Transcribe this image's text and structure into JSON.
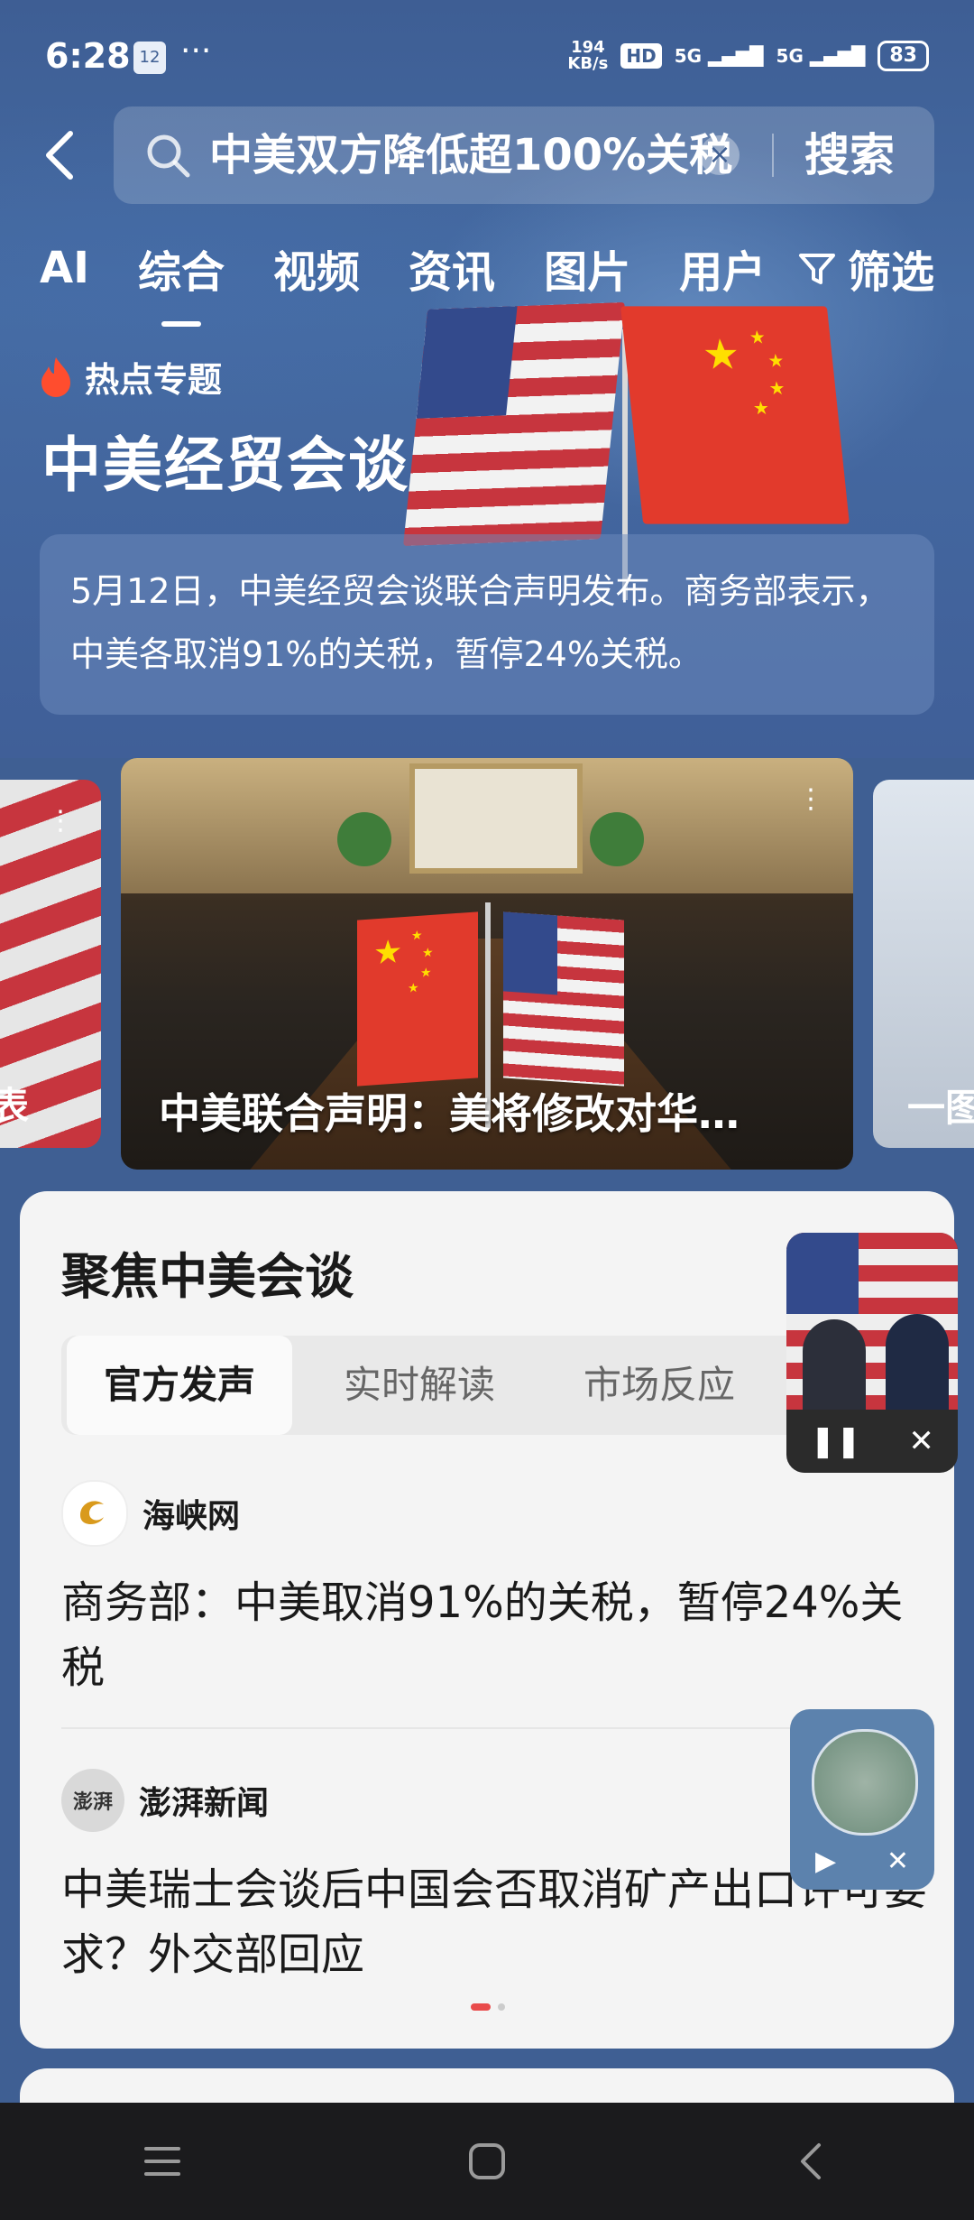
{
  "status_bar": {
    "time": "6:28",
    "notification_badge": "12",
    "more": "···",
    "net_speed_value": "194",
    "net_speed_unit": "KB/s",
    "hd_label": "HD",
    "signal_1": "5G",
    "signal_2": "5G",
    "battery": "83"
  },
  "search": {
    "query": "中美双方降低超100%关税",
    "button_label": "搜索"
  },
  "tabs": [
    "AI",
    "综合",
    "视频",
    "资讯",
    "图片",
    "用户"
  ],
  "active_tab": "综合",
  "filter_label": "筛选",
  "hero": {
    "tag": "热点专题",
    "title": "中美经贸会谈",
    "summary": "5月12日，中美经贸会谈联合声明发布。商务部表示，中美各取消91%的关税，暂停24%关税。"
  },
  "carousel": {
    "left_caption": "表",
    "main_caption": "中美联合声明：美将修改对华…",
    "right_caption": "一图"
  },
  "focus": {
    "title": "聚焦中美会谈",
    "segments": [
      "官方发声",
      "实时解读",
      "市场反应"
    ],
    "active_segment": "官方发声",
    "items": [
      {
        "source": "海峡网",
        "logo_text": "海峡网",
        "title": "商务部：中美取消91%的关税，暂停24%关税"
      },
      {
        "source": "澎湃新闻",
        "logo_text": "澎湃",
        "title": "中美瑞士会谈后中国会否取消矿产出口许可要求？外交部回应"
      }
    ]
  },
  "float_video": {
    "pause_icon": "pause-icon",
    "close_icon": "close-icon"
  },
  "float_audio": {
    "play_icon": "play-icon",
    "close_icon": "close-icon"
  },
  "colors": {
    "hero_bg": "#3f5f93",
    "panel_bg": "#f4f4f4",
    "accent_red": "#e94b4b",
    "navbar_bg": "#1b1b1d"
  }
}
